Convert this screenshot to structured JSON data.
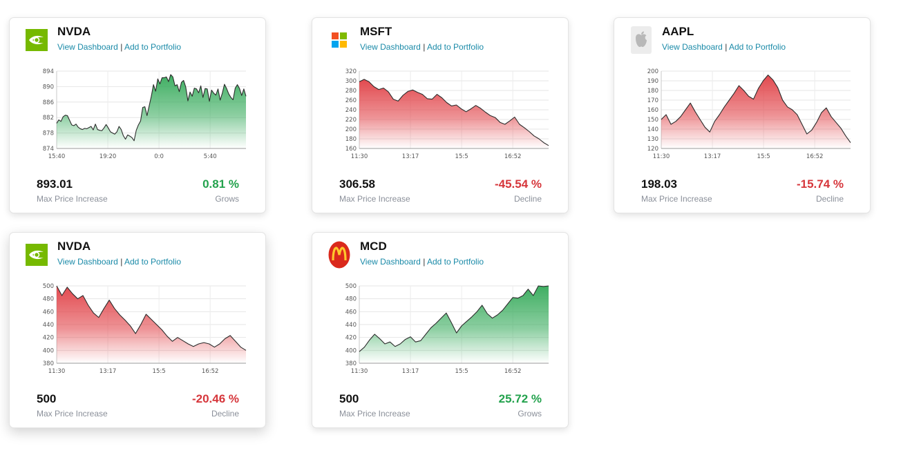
{
  "colors": {
    "up_fill": "#3fae62",
    "down_fill": "#e24a4f",
    "up_text": "#23a24d",
    "down_text": "#d6363b",
    "link": "#1a8aa8"
  },
  "cards": [
    {
      "ticker": "NVDA",
      "logo": "nvidia-logo",
      "view_link": "View Dashboard",
      "separator": "|",
      "add_link": "Add to Portfolio",
      "price": "893.01",
      "price_label": "Max Price Increase",
      "change": "0.81 %",
      "trend_label": "Grows",
      "direction": "up",
      "chart_data": {
        "type": "area",
        "x_ticks": [
          "15:40",
          "19:20",
          "0:0",
          "5:40"
        ],
        "y_ticks": [
          "874",
          "878",
          "882",
          "886",
          "890",
          "894"
        ],
        "ylim": [
          874,
          894
        ],
        "values": [
          880.5,
          881.4,
          881.0,
          882.2,
          882.6,
          882.5,
          881.3,
          880.1,
          879.9,
          880.3,
          879.5,
          879.1,
          878.9,
          879.2,
          879.1,
          879.4,
          879.7,
          878.8,
          880.3,
          878.9,
          878.7,
          878.6,
          879.3,
          880.2,
          879.3,
          878.3,
          878.0,
          877.7,
          878.3,
          879.7,
          878.9,
          877.3,
          876.4,
          877.5,
          877.2,
          876.8,
          876.0,
          878.7,
          880.1,
          881.1,
          884.6,
          884.8,
          882.5,
          885.0,
          887.5,
          890.5,
          888.8,
          892.0,
          890.7,
          892.3,
          892.3,
          892.5,
          891.3,
          893.1,
          892.5,
          890.2,
          890.5,
          888.7,
          891.1,
          891.6,
          889.9,
          886.3,
          888.6,
          887.5,
          889.6,
          889.4,
          888.4,
          890.2,
          887.2,
          889.5,
          889.4,
          886.2,
          889.1,
          888.3,
          887.8,
          889.4,
          886.5,
          888.3,
          890.6,
          889.5,
          888.1,
          887.2,
          886.6,
          889.6,
          890.5,
          889.5,
          887.7,
          889.4,
          887.5
        ]
      }
    },
    {
      "ticker": "MSFT",
      "logo": "microsoft-logo",
      "view_link": "View Dashboard",
      "separator": "|",
      "add_link": "Add to Portfolio",
      "price": "306.58",
      "price_label": "Max Price Increase",
      "change": "-45.54 %",
      "trend_label": "Decline",
      "direction": "down",
      "chart_data": {
        "type": "area",
        "x_ticks": [
          "11:30",
          "13:17",
          "15:5",
          "16:52"
        ],
        "y_ticks": [
          "160",
          "180",
          "200",
          "220",
          "240",
          "260",
          "280",
          "300",
          "320"
        ],
        "ylim": [
          160,
          320
        ],
        "values": [
          298,
          303,
          298,
          288,
          282,
          285,
          277,
          262,
          258,
          270,
          278,
          281,
          276,
          272,
          263,
          262,
          272,
          265,
          255,
          248,
          250,
          242,
          236,
          242,
          249,
          243,
          235,
          228,
          224,
          214,
          210,
          217,
          225,
          210,
          203,
          195,
          186,
          180,
          172,
          166
        ]
      }
    },
    {
      "ticker": "AAPL",
      "logo": "apple-logo",
      "view_link": "View Dashboard",
      "separator": "|",
      "add_link": "Add to Portfolio",
      "price": "198.03",
      "price_label": "Max Price Increase",
      "change": "-15.74 %",
      "trend_label": "Decline",
      "direction": "down",
      "chart_data": {
        "type": "area",
        "x_ticks": [
          "11:30",
          "13:17",
          "15:5",
          "16:52"
        ],
        "y_ticks": [
          "120",
          "130",
          "140",
          "150",
          "160",
          "170",
          "180",
          "190",
          "200"
        ],
        "ylim": [
          120,
          200
        ],
        "values": [
          150,
          155,
          145,
          148,
          153,
          160,
          167,
          158,
          150,
          142,
          137,
          148,
          155,
          163,
          170,
          177,
          185,
          180,
          174,
          171,
          182,
          190,
          196,
          191,
          183,
          170,
          163,
          160,
          155,
          145,
          135,
          139,
          147,
          157,
          162,
          153,
          147,
          141,
          133,
          126
        ]
      }
    },
    {
      "ticker": "NVDA",
      "logo": "nvidia-logo",
      "view_link": "View Dashboard",
      "separator": "|",
      "add_link": "Add to Portfolio",
      "price": "500",
      "price_label": "Max Price Increase",
      "change": "-20.46 %",
      "trend_label": "Decline",
      "direction": "down",
      "chart_data": {
        "type": "area",
        "x_ticks": [
          "11:30",
          "13:17",
          "15:5",
          "16:52"
        ],
        "y_ticks": [
          "380",
          "400",
          "420",
          "440",
          "460",
          "480",
          "500"
        ],
        "ylim": [
          380,
          500
        ],
        "values": [
          500,
          485,
          498,
          488,
          480,
          485,
          470,
          458,
          451,
          465,
          478,
          465,
          455,
          447,
          438,
          426,
          440,
          456,
          448,
          440,
          432,
          422,
          414,
          420,
          415,
          410,
          406,
          410,
          412,
          410,
          405,
          410,
          418,
          423,
          414,
          405,
          400
        ]
      }
    },
    {
      "ticker": "MCD",
      "logo": "mcdonalds-logo",
      "view_link": "View Dashboard",
      "separator": "|",
      "add_link": "Add to Portfolio",
      "price": "500",
      "price_label": "Max Price Increase",
      "change": "25.72 %",
      "trend_label": "Grows",
      "direction": "up",
      "chart_data": {
        "type": "area",
        "x_ticks": [
          "11:30",
          "13:17",
          "15:5",
          "16:52"
        ],
        "y_ticks": [
          "380",
          "400",
          "420",
          "440",
          "460",
          "480",
          "500"
        ],
        "ylim": [
          380,
          500
        ],
        "values": [
          398,
          405,
          416,
          425,
          418,
          410,
          413,
          406,
          410,
          417,
          421,
          413,
          415,
          425,
          435,
          442,
          450,
          458,
          443,
          427,
          438,
          445,
          452,
          460,
          470,
          457,
          450,
          455,
          462,
          472,
          482,
          481,
          485,
          495,
          485,
          500,
          499,
          500
        ]
      }
    }
  ]
}
